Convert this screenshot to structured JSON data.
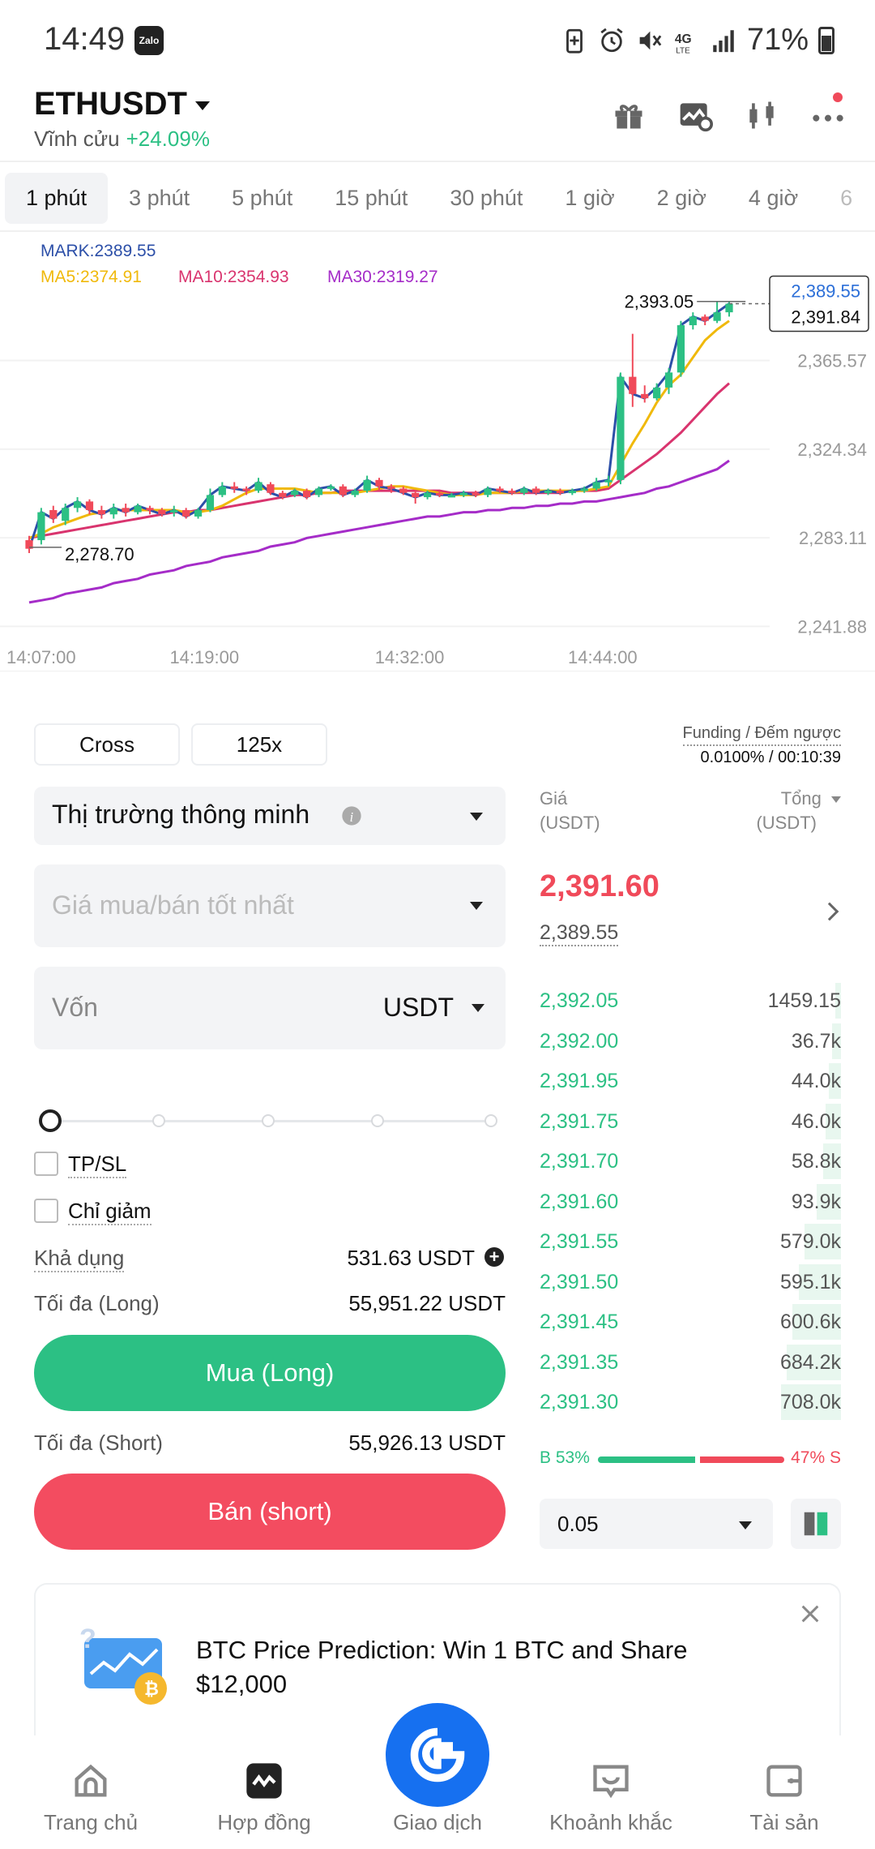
{
  "status": {
    "time": "14:49",
    "zalo": "Zalo",
    "battery": "71%",
    "network": "4G LTE"
  },
  "header": {
    "symbol": "ETHUSDT",
    "market_type": "Vĩnh cửu",
    "change": "+24.09%",
    "icons": [
      "gift-icon",
      "chart-image-icon",
      "candlestick-icon",
      "more-icon"
    ]
  },
  "intervals": [
    "1 phút",
    "3 phút",
    "5 phút",
    "15 phút",
    "30 phút",
    "1 giờ",
    "2 giờ",
    "4 giờ",
    "6"
  ],
  "chart": {
    "mark": "MARK:2389.55",
    "ma5": "MA5:2374.91",
    "ma10": "MA10:2354.93",
    "ma30": "MA30:2319.27",
    "y_ticks": [
      "2,365.57",
      "2,324.34",
      "2,283.11",
      "2,241.88"
    ],
    "x_ticks": [
      "14:07:00",
      "14:19:00",
      "14:32:00",
      "14:44:00"
    ],
    "high_label": "2,393.05",
    "low_label": "2,278.70",
    "mark_tag": "2,389.55",
    "last_tag": "2,391.84",
    "colors": {
      "up": "#2cc084",
      "down": "#f04a5a",
      "mark": "#2c4fa8",
      "ma5": "#f0b90b",
      "ma10": "#d9346e",
      "ma30": "#a52cc8"
    }
  },
  "chart_data": {
    "type": "candlestick",
    "y_range": [
      2236,
      2402
    ],
    "candles": [
      [
        2282,
        2278,
        2284,
        2276
      ],
      [
        2282,
        2295,
        2297,
        2280
      ],
      [
        2296,
        2292,
        2298,
        2290
      ],
      [
        2291,
        2297,
        2299,
        2289
      ],
      [
        2297,
        2300,
        2302,
        2295
      ],
      [
        2300,
        2296,
        2301,
        2294
      ],
      [
        2296,
        2294,
        2298,
        2292
      ],
      [
        2294,
        2297,
        2299,
        2292
      ],
      [
        2297,
        2295,
        2299,
        2293
      ],
      [
        2295,
        2298,
        2299,
        2294
      ],
      [
        2297,
        2296,
        2298,
        2294
      ],
      [
        2296,
        2294,
        2297,
        2293
      ],
      [
        2295,
        2296,
        2298,
        2293
      ],
      [
        2296,
        2293,
        2297,
        2292
      ],
      [
        2293,
        2296,
        2297,
        2292
      ],
      [
        2296,
        2303,
        2306,
        2295
      ],
      [
        2303,
        2307,
        2309,
        2302
      ],
      [
        2307,
        2306,
        2309,
        2304
      ],
      [
        2306,
        2305,
        2307,
        2303
      ],
      [
        2305,
        2309,
        2311,
        2304
      ],
      [
        2308,
        2304,
        2309,
        2303
      ],
      [
        2304,
        2302,
        2305,
        2301
      ],
      [
        2303,
        2305,
        2306,
        2302
      ],
      [
        2305,
        2302,
        2306,
        2301
      ],
      [
        2303,
        2306,
        2307,
        2302
      ],
      [
        2306,
        2307,
        2308,
        2305
      ],
      [
        2307,
        2303,
        2308,
        2302
      ],
      [
        2303,
        2305,
        2306,
        2302
      ],
      [
        2305,
        2310,
        2312,
        2304
      ],
      [
        2310,
        2307,
        2311,
        2305
      ],
      [
        2307,
        2306,
        2308,
        2304
      ],
      [
        2306,
        2304,
        2307,
        2303
      ],
      [
        2304,
        2302,
        2305,
        2299
      ],
      [
        2302,
        2304,
        2305,
        2301
      ],
      [
        2304,
        2303,
        2305,
        2302
      ],
      [
        2303,
        2303,
        2304,
        2302
      ],
      [
        2303,
        2304,
        2305,
        2302
      ],
      [
        2304,
        2303,
        2305,
        2302
      ],
      [
        2303,
        2306,
        2307,
        2302
      ],
      [
        2306,
        2305,
        2307,
        2304
      ],
      [
        2305,
        2304,
        2306,
        2303
      ],
      [
        2304,
        2306,
        2307,
        2303
      ],
      [
        2306,
        2304,
        2307,
        2303
      ],
      [
        2304,
        2305,
        2306,
        2303
      ],
      [
        2305,
        2304,
        2306,
        2303
      ],
      [
        2304,
        2305,
        2306,
        2303
      ],
      [
        2305,
        2306,
        2307,
        2304
      ],
      [
        2306,
        2309,
        2311,
        2305
      ],
      [
        2309,
        2310,
        2312,
        2307
      ],
      [
        2310,
        2358,
        2360,
        2308
      ],
      [
        2358,
        2350,
        2378,
        2344
      ],
      [
        2350,
        2348,
        2354,
        2346
      ],
      [
        2348,
        2353,
        2355,
        2347
      ],
      [
        2353,
        2360,
        2362,
        2350
      ],
      [
        2360,
        2382,
        2384,
        2358
      ],
      [
        2382,
        2386,
        2388,
        2380
      ],
      [
        2386,
        2384,
        2387,
        2382
      ],
      [
        2384,
        2388,
        2393,
        2383
      ],
      [
        2388,
        2392,
        2393,
        2386
      ]
    ],
    "ma5": [
      2283,
      2285,
      2288,
      2290,
      2292,
      2294,
      2295,
      2296,
      2296,
      2296,
      2296,
      2296,
      2296,
      2295,
      2295,
      2296,
      2298,
      2301,
      2304,
      2306,
      2306,
      2306,
      2306,
      2305,
      2304,
      2304,
      2304,
      2304,
      2305,
      2306,
      2307,
      2307,
      2306,
      2305,
      2304,
      2303,
      2303,
      2303,
      2304,
      2304,
      2304,
      2305,
      2305,
      2305,
      2305,
      2305,
      2305,
      2306,
      2307,
      2317,
      2327,
      2336,
      2346,
      2354,
      2359,
      2367,
      2375,
      2380,
      2384
    ],
    "ma10": [
      2283,
      2284,
      2285,
      2286,
      2287,
      2288,
      2289,
      2290,
      2291,
      2292,
      2293,
      2294,
      2295,
      2295,
      2296,
      2296,
      2297,
      2298,
      2299,
      2300,
      2301,
      2302,
      2303,
      2303,
      2304,
      2304,
      2305,
      2305,
      2305,
      2305,
      2305,
      2305,
      2305,
      2305,
      2305,
      2304,
      2304,
      2304,
      2304,
      2304,
      2304,
      2304,
      2304,
      2304,
      2304,
      2305,
      2305,
      2305,
      2306,
      2310,
      2314,
      2318,
      2322,
      2327,
      2332,
      2338,
      2344,
      2350,
      2355
    ],
    "ma30": [
      2253,
      2254,
      2255,
      2257,
      2258,
      2259,
      2260,
      2262,
      2263,
      2264,
      2266,
      2267,
      2268,
      2270,
      2271,
      2272,
      2274,
      2275,
      2276,
      2277,
      2279,
      2280,
      2281,
      2283,
      2284,
      2285,
      2286,
      2287,
      2288,
      2289,
      2290,
      2291,
      2292,
      2293,
      2293,
      2294,
      2295,
      2295,
      2296,
      2296,
      2297,
      2297,
      2298,
      2298,
      2299,
      2299,
      2300,
      2300,
      2301,
      2302,
      2303,
      2304,
      2306,
      2307,
      2309,
      2311,
      2313,
      2315,
      2319
    ]
  },
  "trade": {
    "margin_mode": "Cross",
    "leverage": "125x",
    "funding_label": "Funding / Đếm ngược",
    "funding_value": "0.0100% / 00:10:39",
    "order_type": "Thị trường thông minh",
    "price_placeholder": "Giá mua/bán tốt nhất",
    "amount_label": "Vốn",
    "amount_unit": "USDT",
    "tpsl": "TP/SL",
    "reduce_only": "Chỉ giảm",
    "available_label": "Khả dụng",
    "available_value": "531.63  USDT",
    "max_long_label": "Tối đa (Long)",
    "max_long_value": "55,951.22 USDT",
    "buy_label": "Mua (Long)",
    "max_short_label": "Tối đa (Short)",
    "max_short_value": "55,926.13 USDT",
    "sell_label": "Bán (short)",
    "slider_value": 0
  },
  "orderbook": {
    "price_header": "Giá",
    "price_unit": "(USDT)",
    "total_header": "Tổng",
    "total_unit": "(USDT)",
    "last_price": "2,391.60",
    "mark_price": "2,389.55",
    "rows": [
      {
        "price": "2,392.05",
        "total": "1459.15",
        "depth": 0.02
      },
      {
        "price": "2,392.00",
        "total": "36.7k",
        "depth": 0.03
      },
      {
        "price": "2,391.95",
        "total": "44.0k",
        "depth": 0.04
      },
      {
        "price": "2,391.75",
        "total": "46.0k",
        "depth": 0.05
      },
      {
        "price": "2,391.70",
        "total": "58.8k",
        "depth": 0.06
      },
      {
        "price": "2,391.60",
        "total": "93.9k",
        "depth": 0.08
      },
      {
        "price": "2,391.55",
        "total": "579.0k",
        "depth": 0.12
      },
      {
        "price": "2,391.50",
        "total": "595.1k",
        "depth": 0.14
      },
      {
        "price": "2,391.45",
        "total": "600.6k",
        "depth": 0.16
      },
      {
        "price": "2,391.35",
        "total": "684.2k",
        "depth": 0.18
      },
      {
        "price": "2,391.30",
        "total": "708.0k",
        "depth": 0.2
      }
    ],
    "buy_ratio": "B 53%",
    "sell_ratio": "47% S",
    "precision": "0.05"
  },
  "banner": {
    "text": "BTC Price Prediction: Win 1 BTC and Share $12,000"
  },
  "nav": [
    {
      "label": "Trang chủ"
    },
    {
      "label": "Hợp đồng"
    },
    {
      "label": "Giao dịch"
    },
    {
      "label": "Khoảnh khắc"
    },
    {
      "label": "Tài sản"
    }
  ]
}
